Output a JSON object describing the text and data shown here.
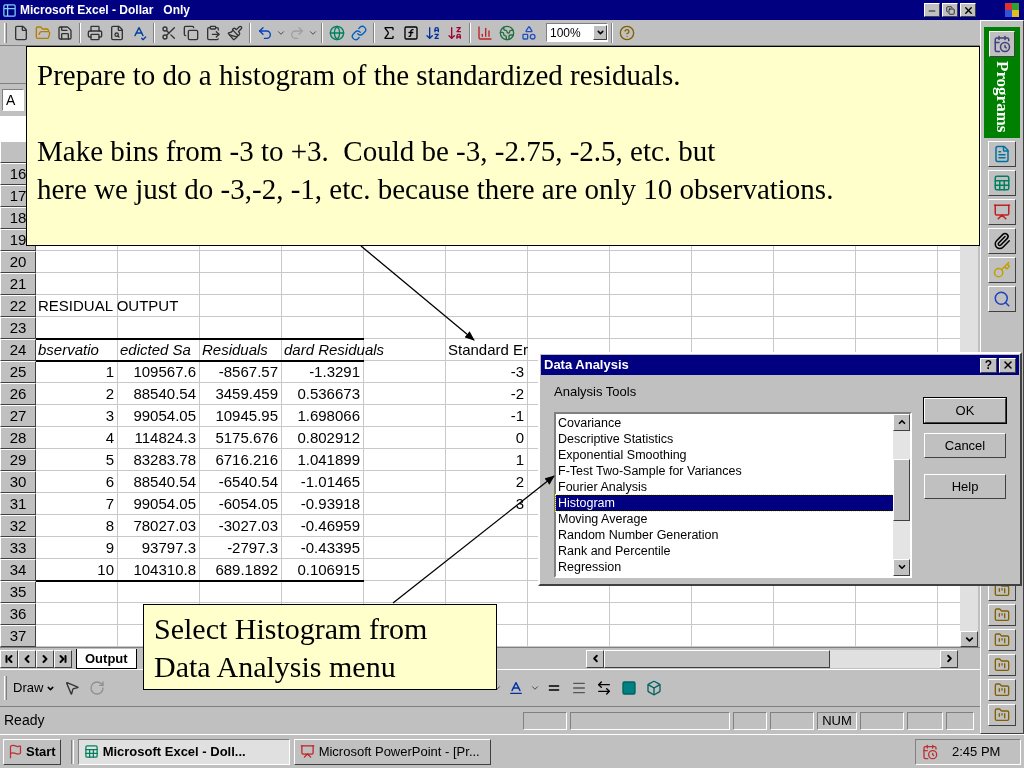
{
  "window": {
    "title": "Microsoft Excel - Dollar   Only"
  },
  "zoom": {
    "value": "100%"
  },
  "name_box": {
    "value": "A"
  },
  "sheet": {
    "rows": [
      {
        "number": "16",
        "kind": "blank"
      },
      {
        "number": "17",
        "kind": "blank"
      },
      {
        "number": "18",
        "kind": "blank"
      },
      {
        "number": "19",
        "kind": "blank"
      },
      {
        "number": "20",
        "kind": "blank"
      },
      {
        "number": "21",
        "kind": "blank"
      },
      {
        "number": "22",
        "kind": "title",
        "cells": [
          "RESIDUAL OUTPUT"
        ]
      },
      {
        "number": "23",
        "kind": "blank"
      },
      {
        "number": "24",
        "kind": "header",
        "cells": [
          "bservatio",
          "edicted Sa",
          "Residuals",
          "dard Residuals"
        ],
        "bin": "Standard Er"
      },
      {
        "number": "25",
        "kind": "data",
        "cells": [
          "1",
          "109567.6",
          "-8567.57",
          "-1.3291"
        ],
        "bin": "-3"
      },
      {
        "number": "26",
        "kind": "data",
        "cells": [
          "2",
          "88540.54",
          "3459.459",
          "0.536673"
        ],
        "bin": "-2"
      },
      {
        "number": "27",
        "kind": "data",
        "cells": [
          "3",
          "99054.05",
          "10945.95",
          "1.698066"
        ],
        "bin": "-1"
      },
      {
        "number": "28",
        "kind": "data",
        "cells": [
          "4",
          "114824.3",
          "5175.676",
          "0.802912"
        ],
        "bin": "0"
      },
      {
        "number": "29",
        "kind": "data",
        "cells": [
          "5",
          "83283.78",
          "6716.216",
          "1.041899"
        ],
        "bin": "1"
      },
      {
        "number": "30",
        "kind": "data",
        "cells": [
          "6",
          "88540.54",
          "-6540.54",
          "-1.01465"
        ],
        "bin": "2"
      },
      {
        "number": "31",
        "kind": "data",
        "cells": [
          "7",
          "99054.05",
          "-6054.05",
          "-0.93918"
        ],
        "bin": "3"
      },
      {
        "number": "32",
        "kind": "data",
        "cells": [
          "8",
          "78027.03",
          "-3027.03",
          "-0.46959"
        ]
      },
      {
        "number": "33",
        "kind": "data",
        "cells": [
          "9",
          "93797.3",
          "-2797.3",
          "-0.43395"
        ]
      },
      {
        "number": "34",
        "kind": "data",
        "cells": [
          "10",
          "104310.8",
          "689.1892",
          "0.106915"
        ]
      },
      {
        "number": "35",
        "kind": "blank"
      },
      {
        "number": "36",
        "kind": "blank"
      },
      {
        "number": "37",
        "kind": "blank"
      }
    ],
    "tabs": [
      {
        "label": "Output",
        "selected": true
      }
    ]
  },
  "drawing_toolbar": {
    "draw_menu": "Draw"
  },
  "status_bar": {
    "text": "Ready",
    "indicators": [
      {
        "label": "NUM",
        "on": true
      }
    ]
  },
  "office_bar": {
    "title": "Programs"
  },
  "dialog": {
    "title": "Data Analysis",
    "help_glyph": "?",
    "label": "Analysis Tools",
    "items": [
      {
        "label": "Covariance",
        "selected": false
      },
      {
        "label": "Descriptive Statistics",
        "selected": false
      },
      {
        "label": "Exponential Smoothing",
        "selected": false
      },
      {
        "label": "F-Test Two-Sample for Variances",
        "selected": false
      },
      {
        "label": "Fourier Analysis",
        "selected": false
      },
      {
        "label": "Histogram",
        "selected": true
      },
      {
        "label": "Moving Average",
        "selected": false
      },
      {
        "label": "Random Number Generation",
        "selected": false
      },
      {
        "label": "Rank and Percentile",
        "selected": false
      },
      {
        "label": "Regression",
        "selected": false
      }
    ],
    "buttons": [
      "OK",
      "Cancel",
      "Help"
    ]
  },
  "callouts": [
    {
      "paragraphs": [
        [
          "Prepare to do a histogram of the standardized residuals."
        ],
        [
          "Make bins from -3 to +3.  Could be -3, -2.75, -2.5, etc. but",
          "here we just do -3,-2, -1, etc. because there are only 10 observations."
        ]
      ]
    },
    {
      "paragraphs": [
        [
          "Select Histogram from",
          "Data Analysis menu"
        ]
      ]
    }
  ],
  "taskbar": {
    "start": "Start",
    "tasks": [
      {
        "label": "Microsoft Excel - Doll...",
        "selected": true
      },
      {
        "label": "Microsoft PowerPoint - [Pr...",
        "selected": false
      }
    ],
    "clock": "2:45 PM"
  }
}
